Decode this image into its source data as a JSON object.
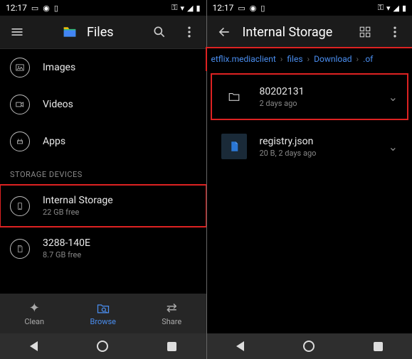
{
  "left": {
    "status": {
      "time": "12:17"
    },
    "app_title": "Files",
    "categories": [
      {
        "label": "Images",
        "icon": "image"
      },
      {
        "label": "Videos",
        "icon": "video"
      },
      {
        "label": "Apps",
        "icon": "android"
      }
    ],
    "section_header": "STORAGE DEVICES",
    "storages": [
      {
        "title": "Internal Storage",
        "sub": "22 GB free",
        "highlight": true
      },
      {
        "title": "3288-140E",
        "sub": "8.7 GB free",
        "highlight": false
      }
    ],
    "nav": {
      "clean": "Clean",
      "browse": "Browse",
      "share": "Share"
    }
  },
  "right": {
    "status": {
      "time": "12:17"
    },
    "app_title": "Internal Storage",
    "breadcrumb": [
      "etflix.mediaclient",
      "files",
      "Download",
      ".of"
    ],
    "entries": [
      {
        "title": "80202131",
        "sub": "2 days ago",
        "type": "folder",
        "highlight": true
      },
      {
        "title": "registry.json",
        "sub": "20 B, 2 days ago",
        "type": "file",
        "highlight": false
      }
    ]
  }
}
